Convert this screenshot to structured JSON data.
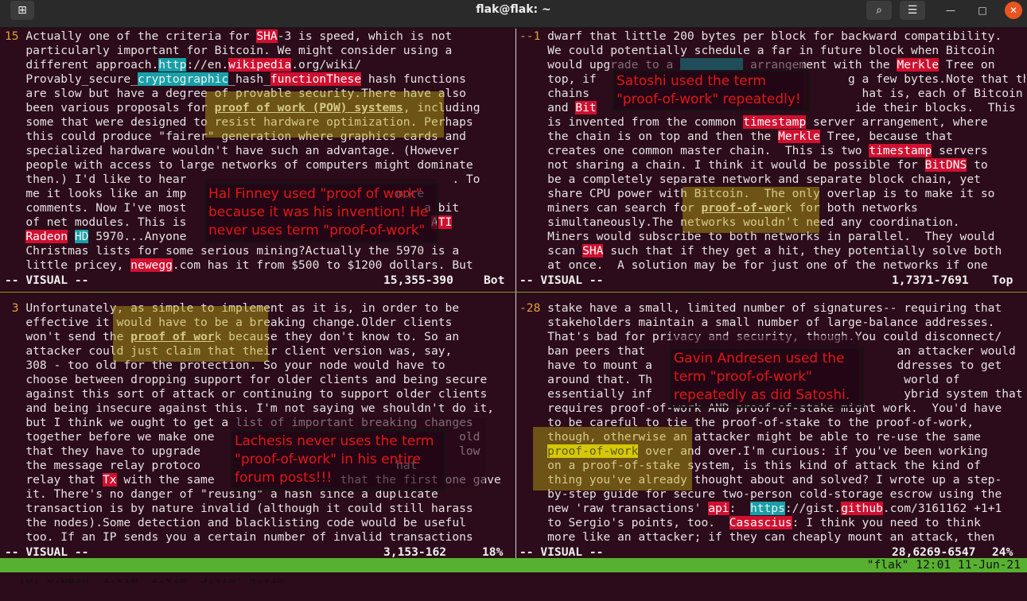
{
  "window": {
    "title": "flak@flak: ~"
  },
  "titlebar": {
    "new_tab_icon": "new-tab-icon",
    "search_icon": "search-icon",
    "menu_icon": "hamburger-menu-icon",
    "minimize": "—",
    "maximize": "□",
    "close": "✕",
    "new_tab_glyph": "⊞",
    "search_glyph": "⌕",
    "menu_glyph": "☰"
  },
  "panes": {
    "top_left": {
      "lines": [
        [
          {
            "t": "15",
            "c": "num"
          },
          {
            "t": " Actually one of the criteria for "
          },
          {
            "t": "SHA",
            "c": "hl-r"
          },
          {
            "t": "-3 is speed, which is not"
          }
        ],
        [
          {
            "t": "   particularly important for Bitcoin. We might consider using a"
          }
        ],
        [
          {
            "t": "   different approach."
          },
          {
            "t": "http",
            "c": "hl-c"
          },
          {
            "t": "://en."
          },
          {
            "t": "wikipedia",
            "c": "hl-r"
          },
          {
            "t": ".org/wiki/"
          }
        ],
        [
          {
            "t": "   Provably_secure_"
          },
          {
            "t": "cryptographic",
            "c": "hl-c"
          },
          {
            "t": "_hash_"
          },
          {
            "t": "functionThese",
            "c": "hl-r"
          },
          {
            "t": " hash functions"
          }
        ],
        [
          {
            "t": "   are slow but have a degree of provable security.There have also"
          }
        ],
        [
          {
            "t": "   been various proposals for "
          },
          {
            "t": "proof of work (POW) systems",
            "c": "u"
          },
          {
            "t": ", including"
          }
        ],
        [
          {
            "t": "   some that were designed to resist hardware optimization. Perhaps"
          }
        ],
        [
          {
            "t": "   this could produce \"fairer\" generation where graphics cards and"
          }
        ],
        [
          {
            "t": "   specialized hardware wouldn't have such an advantage. (However"
          }
        ],
        [
          {
            "t": "   people with access to large networks of computers might dominate"
          }
        ],
        [
          {
            "t": "   then.) I'd like to hear                                      . To"
          }
        ],
        [
          {
            "t": "   me it looks like an imp                              more"
          }
        ],
        [
          {
            "t": "   comments. Now I've most                              "
          },
          {
            "t": "   "
          },
          {
            "t": " a bit"
          }
        ],
        [
          {
            "t": "   of net modules. This is                                   "
          },
          {
            "t": "ATI",
            "c": "hl-r"
          }
        ],
        [
          {
            "t": "   "
          },
          {
            "t": "Radeon",
            "c": "hl-r"
          },
          {
            "t": " "
          },
          {
            "t": "HD",
            "c": "hl-c"
          },
          {
            "t": " 5970...Anyone"
          }
        ],
        [
          {
            "t": "   Christmas lists for some serious mining?Actually the 5970 is a"
          }
        ],
        [
          {
            "t": "   little pricey, "
          },
          {
            "t": "newegg",
            "c": "hl-r"
          },
          {
            "t": ".com has it from $500 to $1200 dollars. But"
          }
        ]
      ],
      "status_mode": "-- VISUAL --",
      "status_pos": "15,355-390",
      "status_scroll": "Bot"
    },
    "top_right": {
      "lines": [
        [
          {
            "t": "--1",
            "c": "num"
          },
          {
            "t": " dwarf that little 200 bytes per block for backward compatibility."
          }
        ],
        [
          {
            "t": "    We could potentially schedule a far in future block when Bitcoin"
          }
        ],
        [
          {
            "t": "    would upgrade to a "
          },
          {
            "t": "         ",
            "c": "hl-c"
          },
          {
            "t": " arrangement with the "
          },
          {
            "t": "Merkle",
            "c": "hl-r"
          },
          {
            "t": " Tree on"
          }
        ],
        [
          {
            "t": "    top, if                                    g a few bytes.Note that the"
          }
        ],
        [
          {
            "t": "    chains                                       hat is, each of Bitcoin"
          }
        ],
        [
          {
            "t": "    and "
          },
          {
            "t": "Bit",
            "c": "hl-r"
          },
          {
            "t": "                                     ide their blocks.  This"
          }
        ],
        [
          {
            "t": "    is invented from the common "
          },
          {
            "t": "timestamp",
            "c": "hl-r"
          },
          {
            "t": " server arrangement, where"
          }
        ],
        [
          {
            "t": "    the chain is on top and then the "
          },
          {
            "t": "Merkle",
            "c": "hl-r"
          },
          {
            "t": " Tree, because that"
          }
        ],
        [
          {
            "t": "    creates one common master chain.  This is two "
          },
          {
            "t": "timestamp",
            "c": "hl-r"
          },
          {
            "t": " servers"
          }
        ],
        [
          {
            "t": "    not sharing a chain. I think it would be possible for "
          },
          {
            "t": "BitDNS",
            "c": "hl-r"
          },
          {
            "t": " to"
          }
        ],
        [
          {
            "t": "    be a completely separate network and separate block chain, yet"
          }
        ],
        [
          {
            "t": "    share CPU power with Bitcoin.  The only overlap is to make it so"
          }
        ],
        [
          {
            "t": "    miners can search for "
          },
          {
            "t": "proof-of-wor",
            "c": "u"
          },
          {
            "t": "k for both networks"
          }
        ],
        [
          {
            "t": "    simultaneously.The networks wouldn't need any coordination."
          }
        ],
        [
          {
            "t": "    Miners would subscribe to both networks in parallel.  They would"
          }
        ],
        [
          {
            "t": "    scan "
          },
          {
            "t": "SHA",
            "c": "hl-r"
          },
          {
            "t": " such that if they get a hit, they potentially solve both"
          }
        ],
        [
          {
            "t": "    at once.  A solution may be for just one of the networks if one"
          }
        ]
      ],
      "status_mode": "-- VISUAL --",
      "status_pos": "1,7371-7691",
      "status_scroll": "Top"
    },
    "bottom_left": {
      "lines": [
        [
          {
            "t": " 3",
            "c": "num"
          },
          {
            "t": " Unfortunately, as simple to implement as it is, in order to be"
          }
        ],
        [
          {
            "t": "   effective it would have to be a breaking change.Older clients"
          }
        ],
        [
          {
            "t": "   won't send the "
          },
          {
            "t": "proof of wor",
            "c": "u"
          },
          {
            "t": "k because they don't know to. So an"
          }
        ],
        [
          {
            "t": "   attacker could just claim that their client version was, say,"
          }
        ],
        [
          {
            "t": "   308 - too old for the protection. So your node would have to"
          }
        ],
        [
          {
            "t": "   choose between dropping support for older clients and being secure"
          }
        ],
        [
          {
            "t": "   against this sort of attack or continuing to support older clients"
          }
        ],
        [
          {
            "t": "   and being insecure against this. I'm not saying we shouldn't do it,"
          }
        ],
        [
          {
            "t": "   but I think we ought to get a list of important breaking changes"
          }
        ],
        [
          {
            "t": "   together before we make one                                   old"
          }
        ],
        [
          {
            "t": "   that they have to upgrade                                     low"
          }
        ],
        [
          {
            "t": "   the message relay protoco                            hat"
          }
        ],
        [
          {
            "t": "   relay that "
          },
          {
            "t": "Tx",
            "c": "hl-r"
          },
          {
            "t": " with the same                  that the first one gave"
          }
        ],
        [
          {
            "t": "   it. There's no danger of \"reusing\" a hash since a duplicate"
          }
        ],
        [
          {
            "t": "   transaction is by nature invalid (although it could still harass"
          }
        ],
        [
          {
            "t": "   the nodes).Some detection and blacklisting code would be useful"
          }
        ],
        [
          {
            "t": "   too. If an IP sends you a certain number of invalid transactions"
          }
        ]
      ],
      "status_mode": "-- VISUAL --",
      "status_pos": "3,153-162",
      "status_scroll": "18%"
    },
    "bottom_right": {
      "lines": [
        [
          {
            "t": "-28",
            "c": "num"
          },
          {
            "t": " stake have a small, limited number of signatures-- requiring that"
          }
        ],
        [
          {
            "t": "    stakeholders maintain a small number of large-balance addresses."
          }
        ],
        [
          {
            "t": "    That's bad for privacy and security, though.You could disconnect/"
          }
        ],
        [
          {
            "t": "    ban peers that                                    an attacker would"
          }
        ],
        [
          {
            "t": "    have to mount a                                   ddresses to get"
          }
        ],
        [
          {
            "t": "    around that. Th                                    world of"
          }
        ],
        [
          {
            "t": "    essentially inf                                    ybrid system that"
          }
        ],
        [
          {
            "t": "    requires proof-of-work AND proof-of-stake might work.  You'd have"
          }
        ],
        [
          {
            "t": "    to be careful to tie the proof-of-stake to the proof-of-work,"
          }
        ],
        [
          {
            "t": "    though, otherwise an attacker might be able to re-use the same"
          }
        ],
        [
          {
            "t": "    "
          },
          {
            "t": "proof-of-work",
            "c": "hl-y"
          },
          {
            "t": " over and over.I'm curious: if you've been working"
          }
        ],
        [
          {
            "t": "    on a proof-of-stake system, is this kind of attack the kind of"
          }
        ],
        [
          {
            "t": "    thing you've already thought about and solved? I wrote up a step-"
          }
        ],
        [
          {
            "t": "    by-step guide for secure two-person cold-storage escrow using the"
          }
        ],
        [
          {
            "t": "    new 'raw transactions' "
          },
          {
            "t": "api",
            "c": "hl-r"
          },
          {
            "t": ":  "
          },
          {
            "t": "https",
            "c": "hl-c"
          },
          {
            "t": "://gist."
          },
          {
            "t": "github",
            "c": "hl-r"
          },
          {
            "t": ".com/3161162 +1+1"
          }
        ],
        [
          {
            "t": "    to Sergio's points, too.  "
          },
          {
            "t": "Casascius",
            "c": "hl-r"
          },
          {
            "t": ": I think you need to think"
          }
        ],
        [
          {
            "t": "    more like an attacker; if they can cheaply mount an attack, then"
          }
        ]
      ],
      "status_mode": "-- VISUAL --",
      "status_pos": "28,6269-6547",
      "status_scroll": "24%"
    }
  },
  "annotations": {
    "hal": "Hal Finney used \"proof of work\" because it was his invention! He never uses term \"proof-of-work\"",
    "satoshi": "Satoshi used the term \"proof-of-work\" repeatedly!",
    "lachesis": "Lachesis never uses the term \"proof-of-work\" in his entire forum posts!!!",
    "gavin": "Gavin Andresen used the term \"proof-of-work\" repeatedly as did Satoshi."
  },
  "tmux": {
    "windows": "[0] 0:bash  1:vim  2:vim  3:vim- 4:vim*",
    "right": "\"flak\" 12:01 11-Jun-21"
  },
  "colors": {
    "highlight_red": "#d01030",
    "highlight_cyan": "#18a0a8",
    "tmux_bar": "#58b030",
    "terminal_bg": "#2c0b1a",
    "note_text": "#e01818"
  }
}
